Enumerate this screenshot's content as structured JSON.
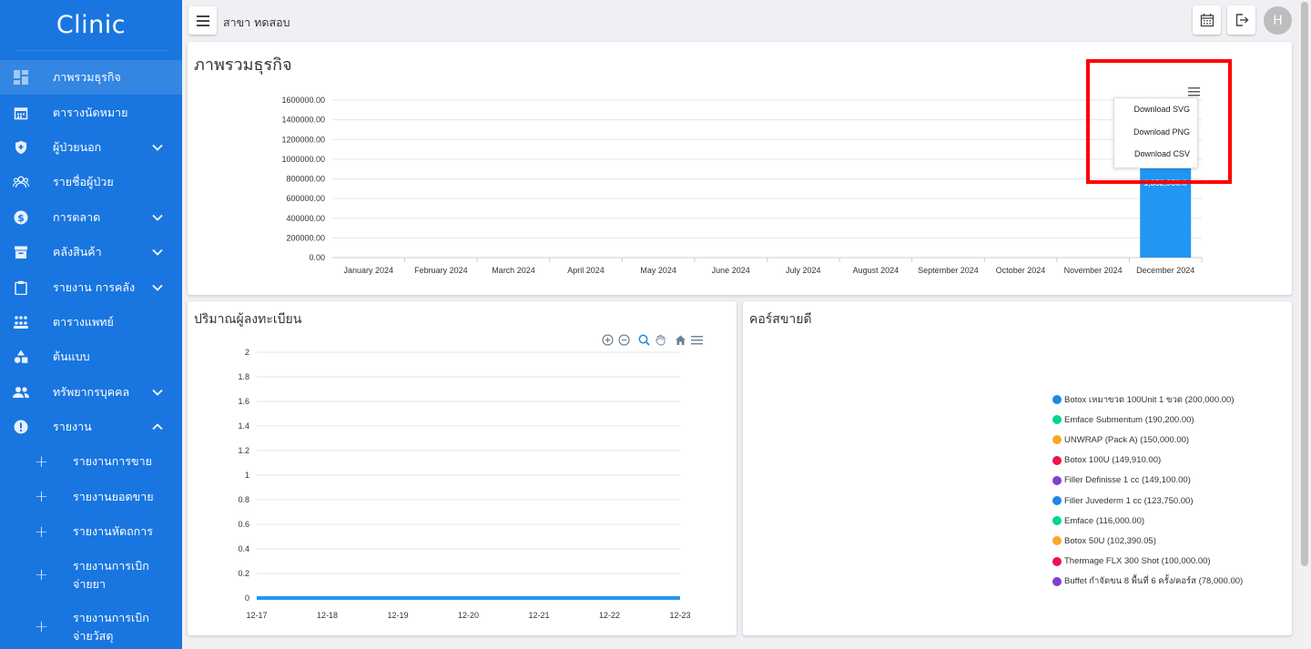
{
  "brand": "Clinic",
  "sidebar": {
    "items": [
      {
        "label": "ภาพรวมธุรกิจ",
        "icon": "dashboard-icon",
        "chevron": ""
      },
      {
        "label": "ตารางนัดหมาย",
        "icon": "calendar-icon",
        "chevron": ""
      },
      {
        "label": "ผู้ป่วยนอก",
        "icon": "shield-icon",
        "chevron": "down"
      },
      {
        "label": "รายชื่อผู้ป่วย",
        "icon": "group-icon",
        "chevron": ""
      },
      {
        "label": "การตลาด",
        "icon": "dollar-icon",
        "chevron": "down"
      },
      {
        "label": "คลังสินค้า",
        "icon": "archive-icon",
        "chevron": "down"
      },
      {
        "label": "รายงาน การคลัง",
        "icon": "clipboard-icon",
        "chevron": "down"
      },
      {
        "label": "ตารางแพทย์",
        "icon": "people-grid-icon",
        "chevron": ""
      },
      {
        "label": "ต้นแบบ",
        "icon": "shapes-icon",
        "chevron": ""
      },
      {
        "label": "ทรัพยากรบุคคล",
        "icon": "people-icon",
        "chevron": "down"
      },
      {
        "label": "รายงาน",
        "icon": "alert-icon",
        "chevron": "up"
      }
    ],
    "subitems": [
      {
        "label": "รายงานการขาย"
      },
      {
        "label": "รายงานยอดขาย"
      },
      {
        "label": "รายงานหัตถการ"
      },
      {
        "label": "รายงานการเบิกจ่ายยา"
      },
      {
        "label": "รายงานการเบิกจ่ายวัสดุ"
      }
    ]
  },
  "topbar": {
    "branch": "สาขา ทดสอบ",
    "avatar": "H"
  },
  "overview": {
    "title": "ภาพรวมธุรกิจ",
    "menu_items": [
      "Download SVG",
      "Download PNG",
      "Download CSV"
    ],
    "partial_label": "1,352,950.0"
  },
  "registrations": {
    "title": "ปริมาณผู้ลงทะเบียน"
  },
  "courses": {
    "title": "คอร์สขายดี"
  },
  "chart_data": [
    {
      "type": "bar",
      "title": "ภาพรวมธุรกิจ",
      "categories": [
        "January 2024",
        "February 2024",
        "March 2024",
        "April 2024",
        "May 2024",
        "June 2024",
        "July 2024",
        "August 2024",
        "September 2024",
        "October 2024",
        "November 2024",
        "December 2024"
      ],
      "values": [
        0,
        0,
        0,
        0,
        0,
        0,
        0,
        0,
        0,
        0,
        0,
        1352950
      ],
      "ylim": [
        0,
        1600000
      ],
      "yticks": [
        "0.00",
        "200000.00",
        "400000.00",
        "600000.00",
        "800000.00",
        "1000000.00",
        "1200000.00",
        "1400000.00",
        "1600000.00"
      ],
      "color": "#2196f3"
    },
    {
      "type": "line",
      "title": "ปริมาณผู้ลงทะเบียน",
      "x": [
        "12-17",
        "12-18",
        "12-19",
        "12-20",
        "12-21",
        "12-22",
        "12-23"
      ],
      "values": [
        0,
        0,
        0,
        0,
        0,
        0,
        0
      ],
      "ylim": [
        0,
        2
      ],
      "yticks": [
        "0",
        "0.2",
        "0.4",
        "0.6",
        "0.8",
        "1",
        "1.2",
        "1.4",
        "1.6",
        "1.8",
        "2"
      ],
      "color": "#2196f3"
    },
    {
      "type": "pie",
      "title": "คอร์สขายดี",
      "legend": [
        {
          "label": "Botox เหมาขวด 100Unit 1 ขวด (200,000.00)",
          "value": 200000,
          "color": "#1e88e5"
        },
        {
          "label": "Emface Submentum (190,200.00)",
          "value": 190200,
          "color": "#00d68f"
        },
        {
          "label": "UNWRAP (Pack A) (150,000.00)",
          "value": 150000,
          "color": "#f9a825"
        },
        {
          "label": "Botox 100U (149,910.00)",
          "value": 149910,
          "color": "#f0134d"
        },
        {
          "label": "Filler Definisse 1 cc (149,100.00)",
          "value": 149100,
          "color": "#7e3fd2"
        },
        {
          "label": "Filler Juvederm 1 cc (123,750.00)",
          "value": 123750,
          "color": "#1e88e5"
        },
        {
          "label": "Emface (116,000.00)",
          "value": 116000,
          "color": "#00d68f"
        },
        {
          "label": "Botox 50U (102,390.05)",
          "value": 102390.05,
          "color": "#f9a825"
        },
        {
          "label": "Thermage FLX 300 Shot (100,000.00)",
          "value": 100000,
          "color": "#f0134d"
        },
        {
          "label": "Buffet กำจัดขน 8 พื้นที่ 6 ครั้ง/คอร์ส (78,000.00)",
          "value": 78000,
          "color": "#7e3fd2"
        }
      ]
    }
  ]
}
